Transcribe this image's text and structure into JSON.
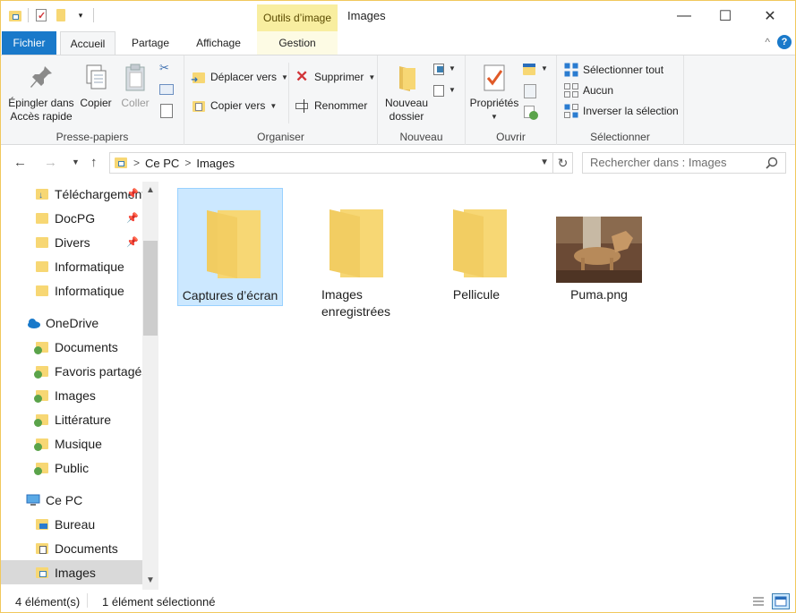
{
  "window": {
    "title": "Images",
    "context_tab": "Outils d’image",
    "controls": {
      "minimize": "—",
      "maximize": "☐",
      "close": "✕"
    }
  },
  "tabs": {
    "file": "Fichier",
    "home": "Accueil",
    "share": "Partage",
    "view": "Affichage",
    "manage": "Gestion",
    "collapse": "^",
    "help": "?"
  },
  "ribbon": {
    "clipboard": {
      "label": "Presse-papiers",
      "pin_line1": "Épingler dans",
      "pin_line2": "Accès rapide",
      "copy": "Copier",
      "paste": "Coller"
    },
    "organize": {
      "label": "Organiser",
      "move_to": "Déplacer vers",
      "copy_to": "Copier vers",
      "delete": "Supprimer",
      "rename": "Renommer"
    },
    "new": {
      "label": "Nouveau",
      "new_folder_line1": "Nouveau",
      "new_folder_line2": "dossier"
    },
    "open": {
      "label": "Ouvrir",
      "properties": "Propriétés"
    },
    "select": {
      "label": "Sélectionner",
      "select_all": "Sélectionner tout",
      "select_none": "Aucun",
      "invert": "Inverser la sélection"
    }
  },
  "address": {
    "crumbs": [
      "Ce PC",
      "Images"
    ],
    "search_placeholder": "Rechercher dans : Images"
  },
  "nav": {
    "quick_access": [
      {
        "label": "Téléchargements",
        "pinned": true
      },
      {
        "label": "DocPG",
        "pinned": true
      },
      {
        "label": "Divers",
        "pinned": true
      },
      {
        "label": "Informatique",
        "pinned": false
      },
      {
        "label": "Informatique",
        "pinned": false
      }
    ],
    "onedrive": {
      "label": "OneDrive",
      "items": [
        "Documents",
        "Favoris partagés",
        "Images",
        "Littérature",
        "Musique",
        "Public"
      ]
    },
    "thispc": {
      "label": "Ce PC",
      "items": [
        "Bureau",
        "Documents",
        "Images"
      ]
    }
  },
  "content": {
    "items": [
      {
        "name": "Captures d’écran",
        "type": "folder",
        "selected": true
      },
      {
        "name": "Images enregistrées",
        "type": "folder",
        "selected": false
      },
      {
        "name": "Pellicule",
        "type": "folder",
        "selected": false
      },
      {
        "name": "Puma.png",
        "type": "image",
        "selected": false
      }
    ]
  },
  "status": {
    "count": "4 élément(s)",
    "selection": "1 élément sélectionné"
  },
  "colors": {
    "accent": "#1979ca",
    "folder": "#f7d774",
    "selection": "#cce8ff",
    "context_tab": "#f8eea0"
  }
}
